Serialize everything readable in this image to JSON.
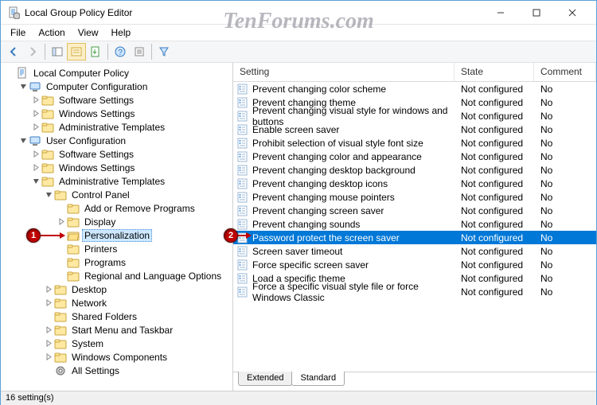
{
  "window": {
    "title": "Local Group Policy Editor"
  },
  "watermark": "TenForums.com",
  "menu": {
    "file": "File",
    "action": "Action",
    "view": "View",
    "help": "Help"
  },
  "tree": {
    "root": "Local Computer Policy",
    "cc": "Computer Configuration",
    "cc_sw": "Software Settings",
    "cc_win": "Windows Settings",
    "cc_adm": "Administrative Templates",
    "uc": "User Configuration",
    "uc_sw": "Software Settings",
    "uc_win": "Windows Settings",
    "uc_adm": "Administrative Templates",
    "cp": "Control Panel",
    "cp_addrem": "Add or Remove Programs",
    "cp_display": "Display",
    "cp_pers": "Personalization",
    "cp_printers": "Printers",
    "cp_programs": "Programs",
    "cp_regional": "Regional and Language Options",
    "desktop": "Desktop",
    "network": "Network",
    "shared": "Shared Folders",
    "startmenu": "Start Menu and Taskbar",
    "system": "System",
    "wincomp": "Windows Components",
    "allset": "All Settings"
  },
  "list": {
    "head": {
      "setting": "Setting",
      "state": "State",
      "comment": "Comment"
    },
    "rows": [
      {
        "s": "Prevent changing color scheme",
        "st": "Not configured",
        "c": "No"
      },
      {
        "s": "Prevent changing theme",
        "st": "Not configured",
        "c": "No"
      },
      {
        "s": "Prevent changing visual style for windows and buttons",
        "st": "Not configured",
        "c": "No"
      },
      {
        "s": "Enable screen saver",
        "st": "Not configured",
        "c": "No"
      },
      {
        "s": "Prohibit selection of visual style font size",
        "st": "Not configured",
        "c": "No"
      },
      {
        "s": "Prevent changing color and appearance",
        "st": "Not configured",
        "c": "No"
      },
      {
        "s": "Prevent changing desktop background",
        "st": "Not configured",
        "c": "No"
      },
      {
        "s": "Prevent changing desktop icons",
        "st": "Not configured",
        "c": "No"
      },
      {
        "s": "Prevent changing mouse pointers",
        "st": "Not configured",
        "c": "No"
      },
      {
        "s": "Prevent changing screen saver",
        "st": "Not configured",
        "c": "No"
      },
      {
        "s": "Prevent changing sounds",
        "st": "Not configured",
        "c": "No"
      },
      {
        "s": "Password protect the screen saver",
        "st": "Not configured",
        "c": "No",
        "sel": true
      },
      {
        "s": "Screen saver timeout",
        "st": "Not configured",
        "c": "No"
      },
      {
        "s": "Force specific screen saver",
        "st": "Not configured",
        "c": "No"
      },
      {
        "s": "Load a specific theme",
        "st": "Not configured",
        "c": "No"
      },
      {
        "s": "Force a specific visual style file or force Windows Classic",
        "st": "Not configured",
        "c": "No"
      }
    ]
  },
  "tabs": {
    "extended": "Extended",
    "standard": "Standard"
  },
  "status": "16 setting(s)",
  "badges": {
    "b1": "1",
    "b2": "2"
  }
}
